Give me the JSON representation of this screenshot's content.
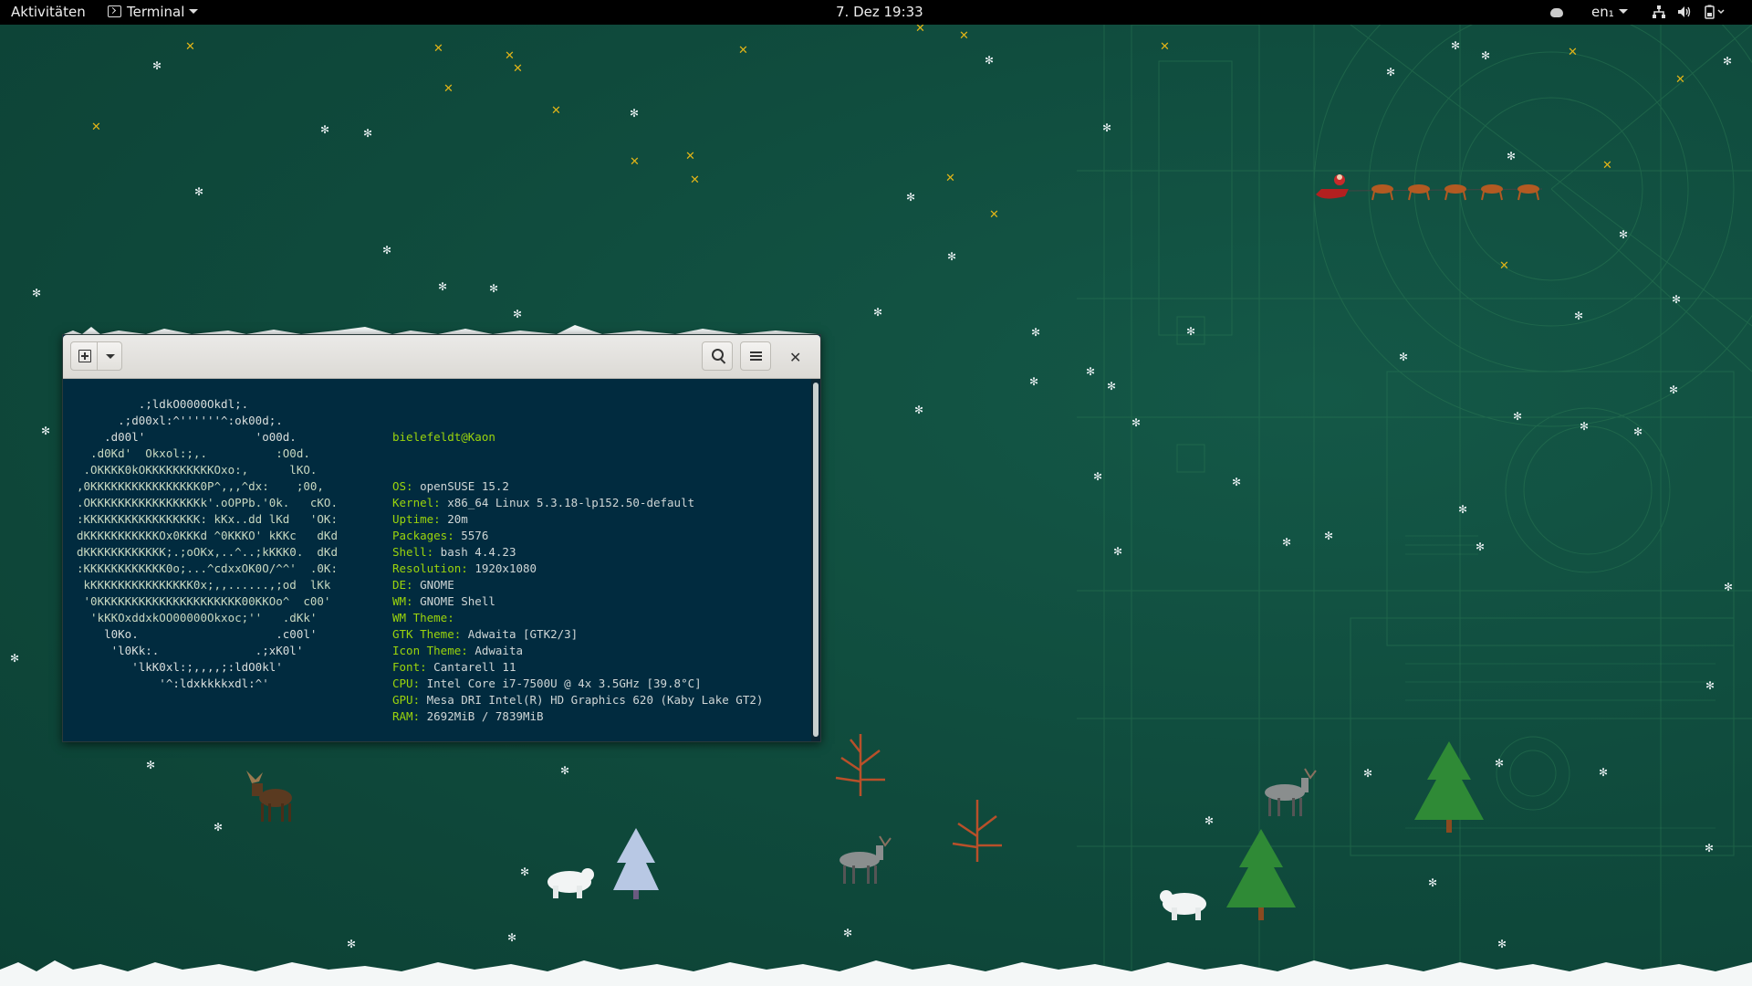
{
  "topbar": {
    "activities": "Aktivitäten",
    "app_menu": "Terminal",
    "clock": "7. Dez 19:33",
    "language": "en₁"
  },
  "terminal": {
    "ascii_lines": [
      "         .;ldkO0000Okdl;.",
      "      .;d00xl:^''''''^:ok00d;.",
      "    .d00l'                'o00d.",
      "  .d0Kd'  Okxol:;,.          :O0d.",
      " .OKKKK0kOKKKKKKKKKKOxo:,      lKO.",
      ",0KKKKKKKKKKKKKKKK0P^,,,^dx:    ;00,",
      ".OKKKKKKKKKKKKKKKKk'.oOPPb.'0k.   cKO.",
      ":KKKKKKKKKKKKKKKKK: kKx..dd lKd   'OK:",
      "dKKKKKKKKKKKOx0KKKd ^0KKKO' kKKc   dKd",
      "dKKKKKKKKKKKK;.;oOKx,..^..;kKKK0.  dKd",
      ":KKKKKKKKKKKK0o;...^cdxxOK0O/^^'  .0K:",
      " kKKKKKKKKKKKKKKK0x;,,......,;od  lKk",
      " '0KKKKKKKKKKKKKKKKKKKKK00KKOo^  c00'",
      "  'kKKOxddxkOO00000Okxoc;''   .dKk'",
      "    l0Ko.                    .c00l'",
      "     'l0Kk:.              .;xK0l'",
      "        'lkK0xl:;,,,,;:ldO0kl'",
      "            '^:ldxkkkkxdl:^'"
    ],
    "user_host": "bielefeldt@Kaon",
    "info": [
      {
        "label": "OS:",
        "value": " openSUSE 15.2"
      },
      {
        "label": "Kernel:",
        "value": " x86_64 Linux 5.3.18-lp152.50-default"
      },
      {
        "label": "Uptime:",
        "value": " 20m"
      },
      {
        "label": "Packages:",
        "value": " 5576"
      },
      {
        "label": "Shell:",
        "value": " bash 4.4.23"
      },
      {
        "label": "Resolution:",
        "value": " 1920x1080"
      },
      {
        "label": "DE:",
        "value": " GNOME"
      },
      {
        "label": "WM:",
        "value": " GNOME Shell"
      },
      {
        "label": "WM Theme:",
        "value": ""
      },
      {
        "label": "GTK Theme:",
        "value": " Adwaita [GTK2/3]"
      },
      {
        "label": "Icon Theme:",
        "value": " Adwaita"
      },
      {
        "label": "Font:",
        "value": " Cantarell 11"
      },
      {
        "label": "CPU:",
        "value": " Intel Core i7-7500U @ 4x 3.5GHz [39.8°C]"
      },
      {
        "label": "GPU:",
        "value": " Mesa DRI Intel(R) HD Graphics 620 (Kaby Lake GT2)"
      },
      {
        "label": "RAM:",
        "value": " 2692MiB / 7839MiB"
      }
    ]
  },
  "colors": {
    "desktop_bg": "#0f4a3c",
    "terminal_bg": "#012b3f",
    "accent_green": "#9bd40c",
    "star": "#e0b418"
  },
  "icons": {
    "app_menu": "terminal-icon",
    "weather": "weather-icon",
    "network": "network-icon",
    "volume": "volume-icon",
    "power": "battery-icon"
  }
}
